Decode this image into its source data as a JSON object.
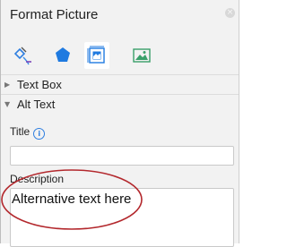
{
  "pane": {
    "title": "Format Picture",
    "close_glyph": "×",
    "tabs": [
      {
        "icon": "fill-line-icon",
        "selected": false
      },
      {
        "icon": "effects-icon",
        "selected": false
      },
      {
        "icon": "size-properties-icon",
        "selected": true
      },
      {
        "icon": "picture-icon",
        "selected": false
      }
    ]
  },
  "sections": {
    "text_box": {
      "label": "Text Box",
      "chevron": "▶"
    },
    "alt_text": {
      "label": "Alt Text",
      "chevron": "▼"
    }
  },
  "alt_text": {
    "title_label": "Title",
    "title_value": "",
    "info_glyph": "i",
    "description_label": "Description",
    "description_value": "Alternative text here"
  },
  "colors": {
    "accent": "#2f7fe0",
    "annotation": "#b3282d",
    "pane_bg": "#f2f2f2"
  }
}
